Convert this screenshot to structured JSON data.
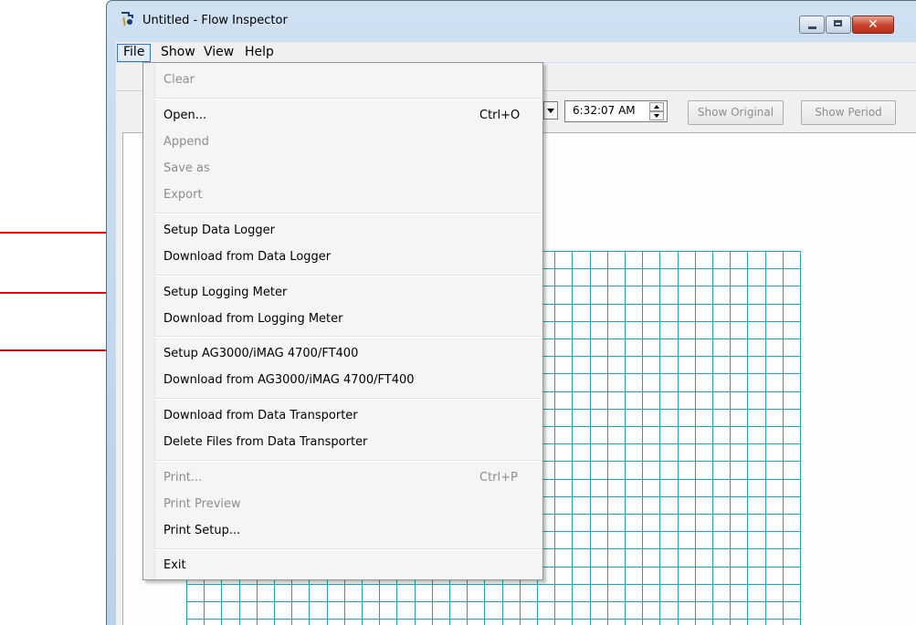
{
  "window": {
    "title": "Untitled - Flow Inspector"
  },
  "menubar": {
    "items": [
      "File",
      "Show",
      "View",
      "Help"
    ]
  },
  "toolbar": {
    "time_value": "6:32:07 AM",
    "show_original_label": "Show Original",
    "show_period_label": "Show Period"
  },
  "file_menu": {
    "clear": "Clear",
    "open": "Open...",
    "open_shortcut": "Ctrl+O",
    "append": "Append",
    "save_as": "Save as",
    "export": "Export",
    "setup_data_logger": "Setup Data Logger",
    "download_data_logger": "Download from Data Logger",
    "setup_logging_meter": "Setup Logging Meter",
    "download_logging_meter": "Download from Logging Meter",
    "setup_ag3000": "Setup AG3000/iMAG 4700/FT400",
    "download_ag3000": "Download from AG3000/iMAG 4700/FT400",
    "download_transporter": "Download from Data Transporter",
    "delete_transporter": "Delete Files from Data Transporter",
    "print": "Print...",
    "print_shortcut": "Ctrl+P",
    "print_preview": "Print Preview",
    "print_setup": "Print Setup...",
    "exit": "Exit"
  },
  "colors": {
    "grid": "#1da2b5",
    "annotation_arrow": "#e8000a",
    "disabled_text": "#8d8d8d"
  },
  "icons": [
    "app-icon",
    "minimize-icon",
    "maximize-icon",
    "close-icon",
    "dropdown-arrow-icon",
    "spin-up-icon",
    "spin-down-icon"
  ]
}
